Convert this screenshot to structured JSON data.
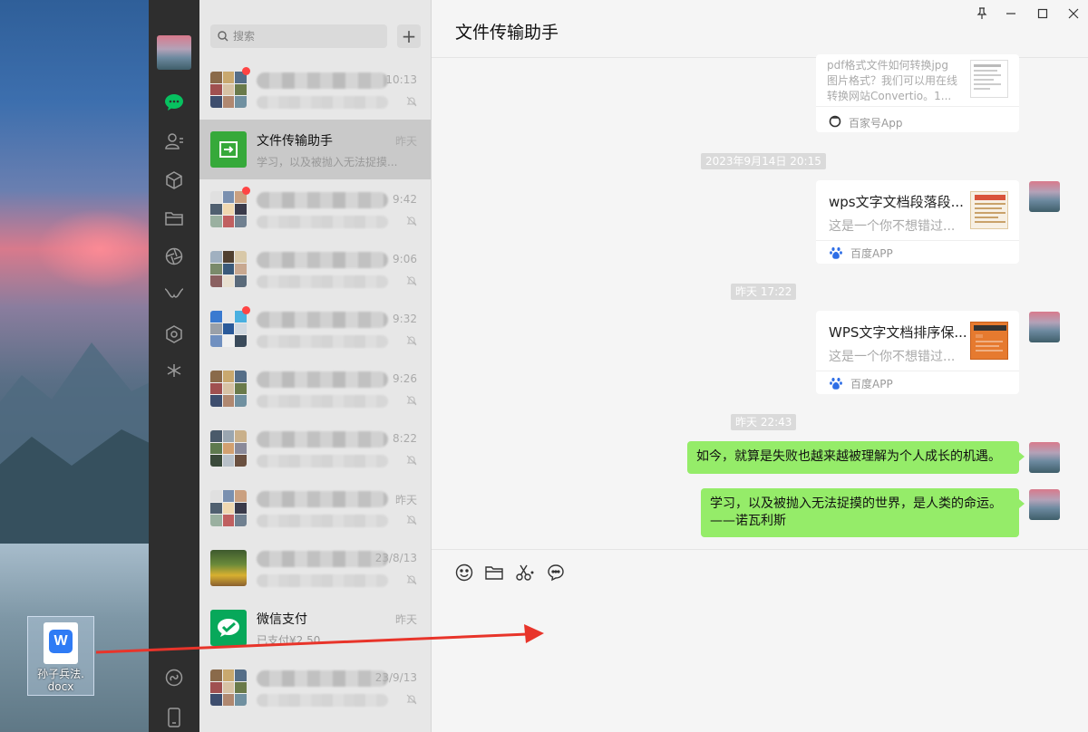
{
  "desktop": {
    "file_name_line1": "孙子兵法.",
    "file_name_line2": "docx"
  },
  "search": {
    "placeholder": "搜索"
  },
  "chats": [
    {
      "name": "",
      "preview": "",
      "time": "10:13",
      "unread": true,
      "blurred": true
    },
    {
      "name": "文件传输助手",
      "preview": "学习，以及被抛入无法捉摸...",
      "time": "昨天",
      "unread": false,
      "blurred": false
    },
    {
      "name": "",
      "preview": "",
      "time": "9:42",
      "unread": true,
      "blurred": true
    },
    {
      "name": "",
      "preview": "",
      "time": "9:06",
      "unread": false,
      "blurred": true
    },
    {
      "name": "",
      "preview": "",
      "time": "9:32",
      "unread": true,
      "blurred": true
    },
    {
      "name": "",
      "preview": "",
      "time": "9:26",
      "unread": false,
      "blurred": true
    },
    {
      "name": "",
      "preview": "",
      "time": "8:22",
      "unread": false,
      "blurred": true
    },
    {
      "name": "",
      "preview": "",
      "time": "昨天",
      "unread": false,
      "blurred": true
    },
    {
      "name": "",
      "preview": "",
      "time": "23/8/13",
      "unread": false,
      "blurred": true
    },
    {
      "name": "微信支付",
      "preview": "已支付¥2.50",
      "time": "昨天",
      "unread": false,
      "blurred": false
    },
    {
      "name": "",
      "preview": "",
      "time": "23/9/13",
      "unread": false,
      "blurred": true
    }
  ],
  "main": {
    "title": "文件传输助手",
    "messages": {
      "card0": {
        "desc_line1": "pdf格式文件如何转换jpg",
        "desc_line2": "图片格式？我们可以用在线",
        "desc_line3": "转换网站Convertio。1...",
        "source": "百家号App"
      },
      "ts1": "2023年9月14日 20:15",
      "card1": {
        "title": "wps文字文档段落段...",
        "desc": "这是一个你不想错过...",
        "source": "百度APP"
      },
      "ts2": "昨天 17:22",
      "card2": {
        "title": "WPS文字文档排序保...",
        "desc": "这是一个你不想错过...",
        "source": "百度APP"
      },
      "ts3": "昨天 22:43",
      "text1": "如今，就算是失败也越来越被理解为个人成长的机遇。",
      "text2_line1": "学习，以及被抛入无法捉摸的世界，是人类的命运。",
      "text2_line2": "——诺瓦利斯"
    }
  },
  "colors": {
    "bubble_green": "#95ec69",
    "accent_green": "#07c160",
    "unread_red": "#f44444",
    "arrow_red": "#e8342a"
  }
}
